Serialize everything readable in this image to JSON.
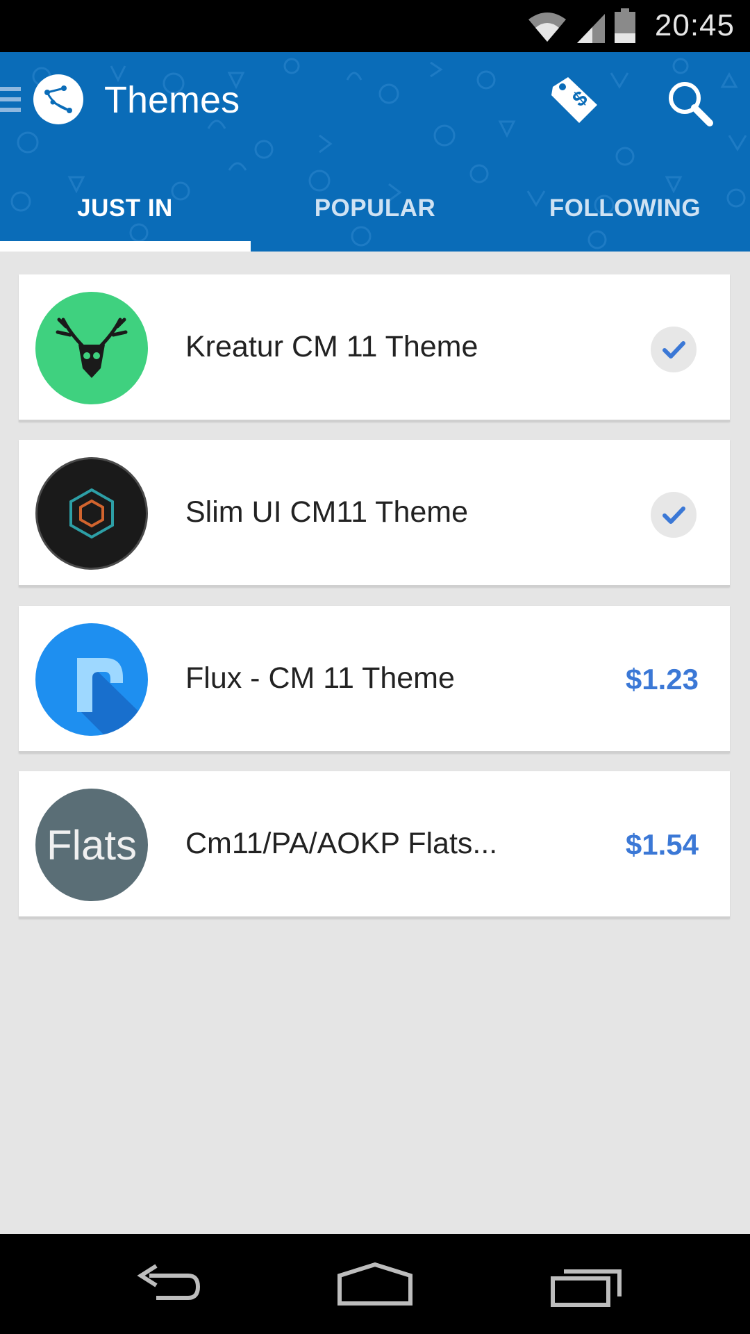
{
  "status_bar": {
    "time": "20:45",
    "icons": [
      "wifi-icon",
      "signal-icon",
      "battery-icon"
    ]
  },
  "app_bar": {
    "title": "Themes",
    "actions": [
      "price-tag-icon",
      "search-icon"
    ],
    "background_color": "#0a6cb8"
  },
  "tabs": [
    {
      "label": "JUST IN",
      "active": true
    },
    {
      "label": "POPULAR",
      "active": false
    },
    {
      "label": "FOLLOWING",
      "active": false
    }
  ],
  "themes": [
    {
      "name": "Kreatur CM 11 Theme",
      "status": "installed",
      "price": null,
      "icon": "deer-skull-icon",
      "icon_color": "#3fd17f"
    },
    {
      "name": "Slim UI CM11 Theme",
      "status": "installed",
      "price": null,
      "icon": "hexagon-logo-icon",
      "icon_color": "#1a1a1a"
    },
    {
      "name": "Flux - CM 11 Theme",
      "status": "paid",
      "price": "$1.23",
      "icon": "flux-f-icon",
      "icon_color": "#1e8ff0"
    },
    {
      "name": "Cm11/PA/AOKP Flats...",
      "status": "paid",
      "price": "$1.54",
      "icon": "flats-text-icon",
      "icon_label": "Flats",
      "icon_color": "#5a6e76"
    }
  ],
  "accent_color": "#3b78d6",
  "nav_bar": {
    "buttons": [
      "back-icon",
      "home-icon",
      "recents-icon"
    ]
  }
}
